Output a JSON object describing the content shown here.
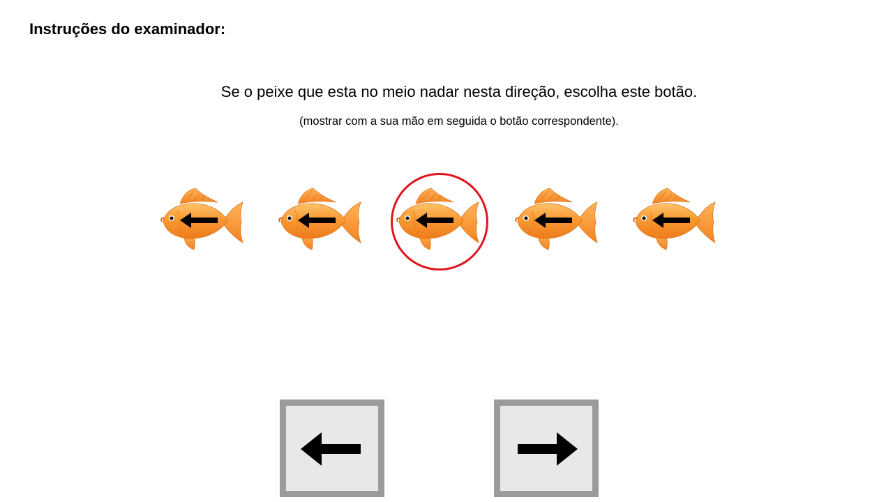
{
  "header": {
    "title": "Instruções do examinador:"
  },
  "instructions": {
    "main": "Se o peixe que esta no meio nadar nesta direção, escolha este botão.",
    "sub": "(mostrar com a sua mão em seguida o botão correspondente)."
  },
  "stimulus": {
    "fish": [
      {
        "icon": "fish-icon",
        "arrow": "left"
      },
      {
        "icon": "fish-icon",
        "arrow": "left"
      },
      {
        "icon": "fish-icon",
        "arrow": "left",
        "target": true
      },
      {
        "icon": "fish-icon",
        "arrow": "left"
      },
      {
        "icon": "fish-icon",
        "arrow": "left"
      }
    ],
    "highlight_color": "#e0141c"
  },
  "response_buttons": [
    {
      "icon": "arrow-left-icon",
      "direction": "left"
    },
    {
      "icon": "arrow-right-icon",
      "direction": "right"
    }
  ],
  "colors": {
    "fish_body": "#f7962a",
    "button_border": "#9b9b9b",
    "button_fill": "#e8e8e8"
  }
}
